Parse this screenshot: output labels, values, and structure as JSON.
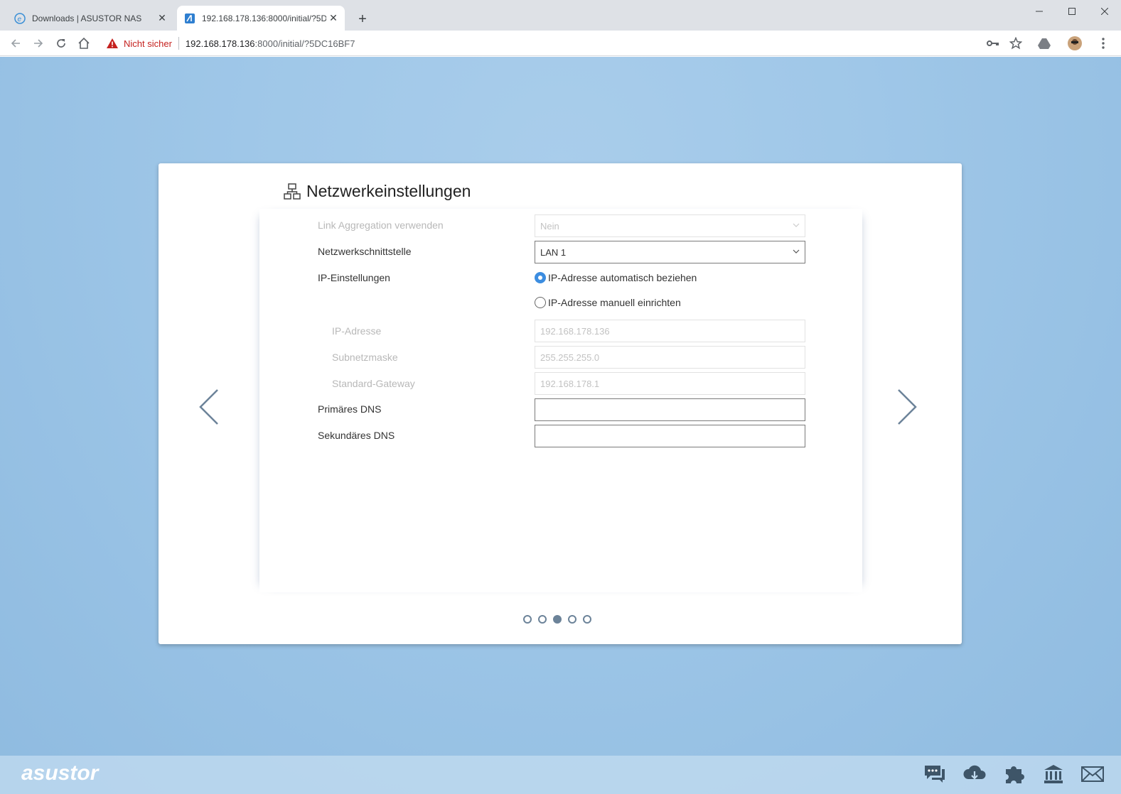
{
  "browser": {
    "tabs": [
      {
        "title": "Downloads | ASUSTOR NAS",
        "icon": "asustor-e-favicon"
      },
      {
        "title": "192.168.178.136:8000/initial/?5D",
        "icon": "asustor-a-favicon"
      }
    ],
    "security_label": "Nicht sicher",
    "url_host": "192.168.178.136",
    "url_rest": ":8000/initial/?5DC16BF7"
  },
  "dialog": {
    "title": "Netzwerkeinstellungen",
    "title_icon": "network-icon",
    "link_aggregation": {
      "label": "Link Aggregation verwenden",
      "value": "Nein"
    },
    "interface": {
      "label": "Netzwerkschnittstelle",
      "value": "LAN 1"
    },
    "ip_settings": {
      "label": "IP-Einstellungen",
      "option_auto": "IP-Adresse automatisch beziehen",
      "option_manual": "IP-Adresse manuell einrichten",
      "selected": "auto"
    },
    "ip_address": {
      "label": "IP-Adresse",
      "value": "192.168.178.136"
    },
    "subnet": {
      "label": "Subnetzmaske",
      "value": "255.255.255.0"
    },
    "gateway": {
      "label": "Standard-Gateway",
      "value": "192.168.178.1"
    },
    "dns_primary": {
      "label": "Primäres DNS",
      "value": ""
    },
    "dns_secondary": {
      "label": "Sekundäres DNS",
      "value": ""
    },
    "pager": {
      "total": 5,
      "current": 3
    }
  },
  "footer": {
    "logo": "asustor",
    "icons": [
      "chat-icon",
      "cloud-download-icon",
      "puzzle-icon",
      "bank-icon",
      "mail-icon"
    ]
  },
  "colors": {
    "accent": "#3c8de0",
    "background": "#9fc7e8",
    "warning": "#c5221f"
  }
}
